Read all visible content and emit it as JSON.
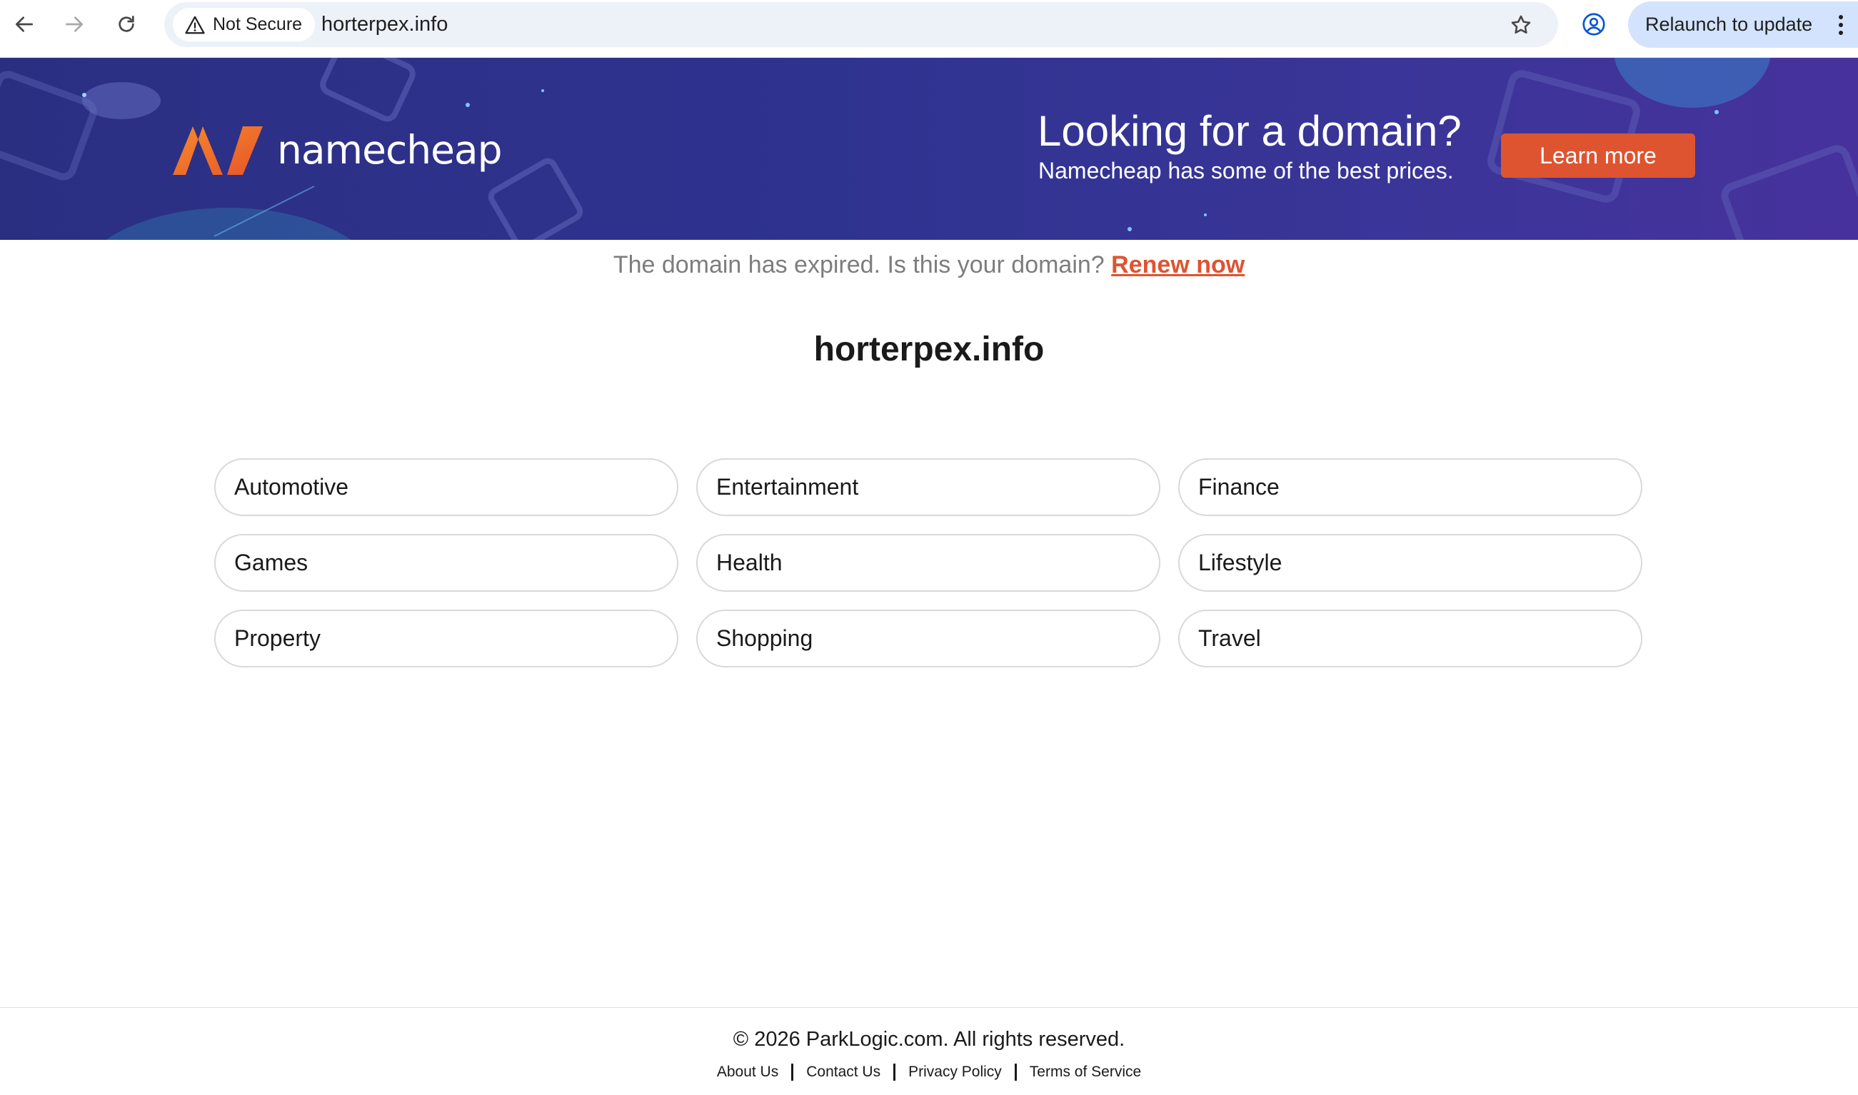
{
  "browser": {
    "security_label": "Not Secure",
    "url": "horterpex.info",
    "relaunch_label": "Relaunch to update"
  },
  "banner": {
    "logo_text": "namecheap",
    "headline": "Looking for a domain?",
    "subheadline": "Namecheap has some of the best prices.",
    "cta_label": "Learn more",
    "colors": {
      "background": "#2f3390",
      "accent": "#de5431",
      "logo_orange": "#f26a2b"
    }
  },
  "notice": {
    "text": "The domain has expired. Is this your domain? ",
    "link_label": "Renew now"
  },
  "domain_title": "horterpex.info",
  "categories": [
    "Automotive",
    "Entertainment",
    "Finance",
    "Games",
    "Health",
    "Lifestyle",
    "Property",
    "Shopping",
    "Travel"
  ],
  "footer": {
    "copyright": "© 2026 ParkLogic.com. All rights reserved.",
    "links": [
      "About Us",
      "Contact Us",
      "Privacy Policy",
      "Terms of Service"
    ]
  },
  "icons": {
    "back": "arrow-left-icon",
    "forward": "arrow-right-icon",
    "reload": "reload-icon",
    "warning": "warning-triangle-icon",
    "bookmark": "star-icon",
    "profile": "profile-icon",
    "menu": "vertical-dots-icon"
  }
}
